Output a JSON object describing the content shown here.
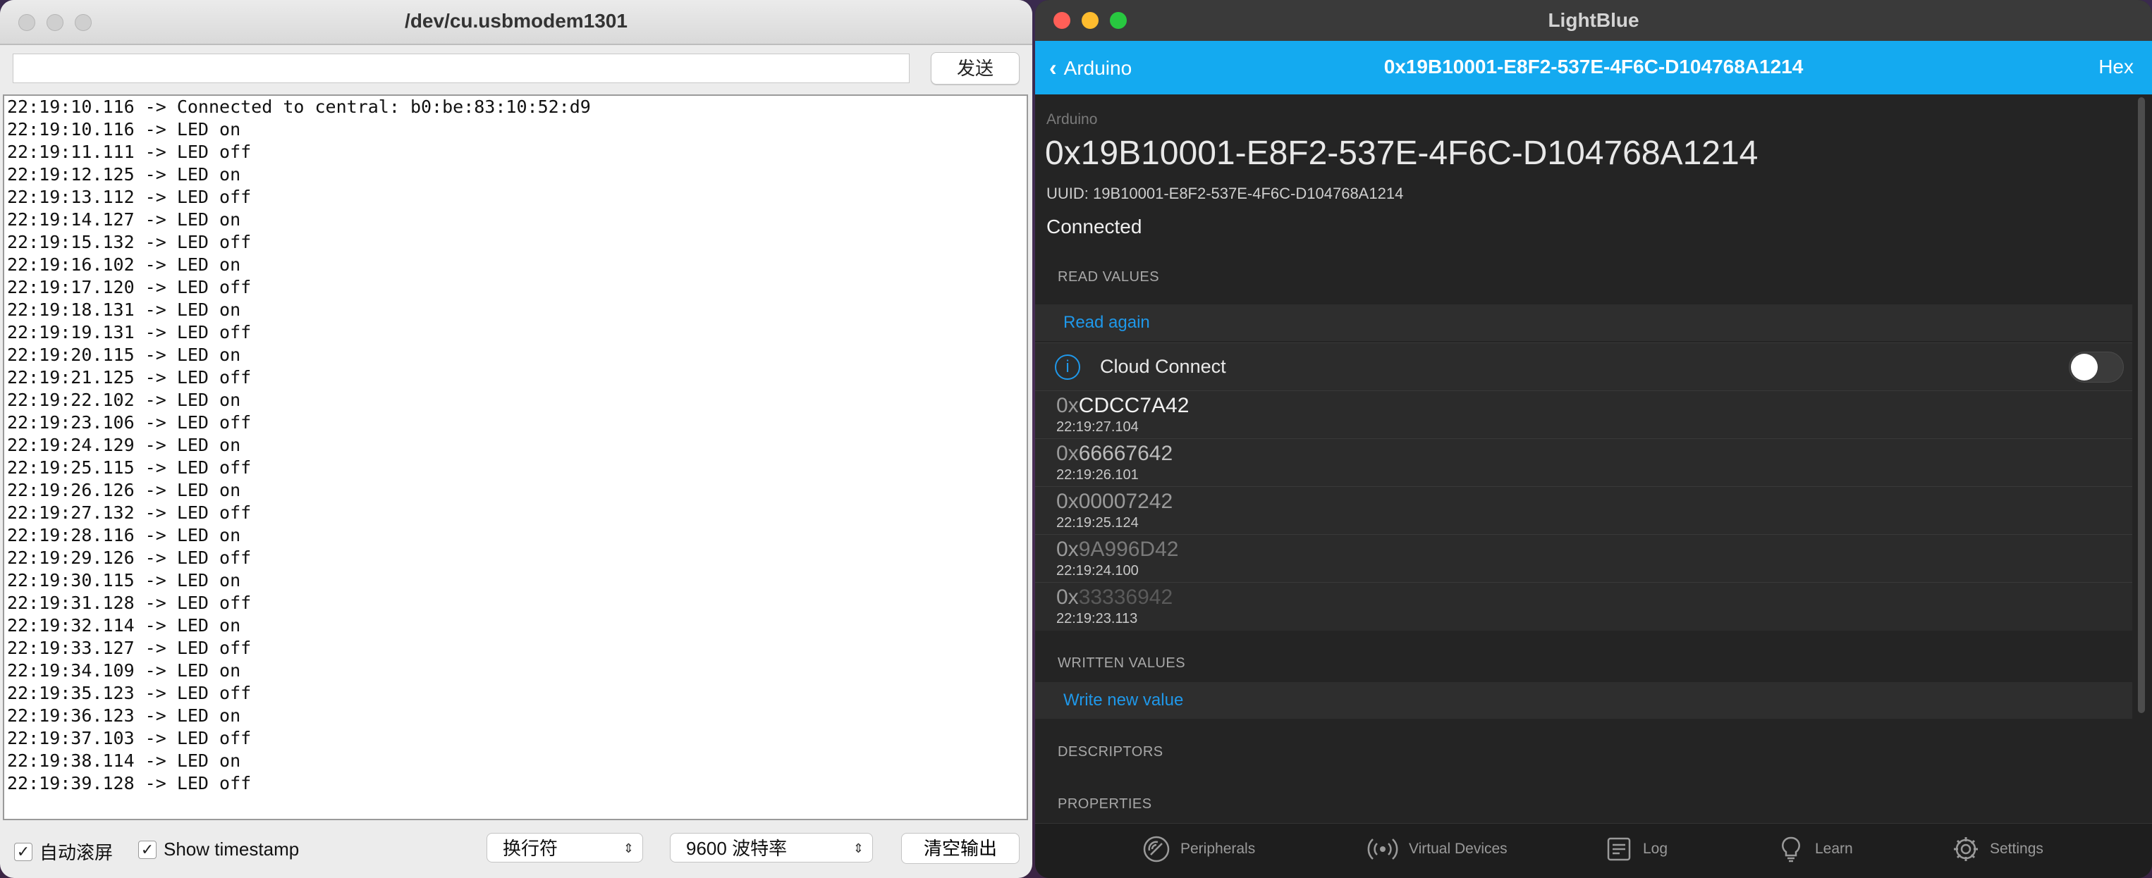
{
  "serial": {
    "title": "/dev/cu.usbmodem1301",
    "send_label": "发送",
    "send_value": "",
    "log": [
      "22:19:10.116 -> Connected to central: b0:be:83:10:52:d9",
      "22:19:10.116 -> LED on",
      "22:19:11.111 -> LED off",
      "22:19:12.125 -> LED on",
      "22:19:13.112 -> LED off",
      "22:19:14.127 -> LED on",
      "22:19:15.132 -> LED off",
      "22:19:16.102 -> LED on",
      "22:19:17.120 -> LED off",
      "22:19:18.131 -> LED on",
      "22:19:19.131 -> LED off",
      "22:19:20.115 -> LED on",
      "22:19:21.125 -> LED off",
      "22:19:22.102 -> LED on",
      "22:19:23.106 -> LED off",
      "22:19:24.129 -> LED on",
      "22:19:25.115 -> LED off",
      "22:19:26.126 -> LED on",
      "22:19:27.132 -> LED off",
      "22:19:28.116 -> LED on",
      "22:19:29.126 -> LED off",
      "22:19:30.115 -> LED on",
      "22:19:31.128 -> LED off",
      "22:19:32.114 -> LED on",
      "22:19:33.127 -> LED off",
      "22:19:34.109 -> LED on",
      "22:19:35.123 -> LED off",
      "22:19:36.123 -> LED on",
      "22:19:37.103 -> LED off",
      "22:19:38.114 -> LED on",
      "22:19:39.128 -> LED off"
    ],
    "autoscroll_label": "自动滚屏",
    "autoscroll_checked": true,
    "timestamp_label": "Show timestamp",
    "timestamp_checked": true,
    "line_ending": "换行符",
    "baud": "9600 波特率",
    "clear_label": "清空输出"
  },
  "lightblue": {
    "title": "LightBlue",
    "back_label": "Arduino",
    "nav_title": "0x19B10001-E8F2-537E-4F6C-D104768A1214",
    "hex_label": "Hex",
    "service_label": "Arduino",
    "big_uuid": "0x19B10001-E8F2-537E-4F6C-D104768A1214",
    "uuid_line": "UUID: 19B10001-E8F2-537E-4F6C-D104768A1214",
    "status": "Connected",
    "read_header": "READ VALUES",
    "read_again": "Read again",
    "cloud_label": "Cloud Connect",
    "cloud_enabled": false,
    "values": [
      {
        "prefix": "0x",
        "hex": "CDCC7A42",
        "time": "22:19:27.104",
        "color": "#f2f2f2"
      },
      {
        "prefix": "0x",
        "hex": "66667642",
        "time": "22:19:26.101",
        "color": "#bdbdbd"
      },
      {
        "prefix": "0x",
        "hex": "00007242",
        "time": "22:19:25.124",
        "color": "#9a9a9a"
      },
      {
        "prefix": "0x",
        "hex": "9A996D42",
        "time": "22:19:24.100",
        "color": "#7a7a7a"
      },
      {
        "prefix": "0x",
        "hex": "33336942",
        "time": "22:19:23.113",
        "color": "#5a5a5a"
      }
    ],
    "written_header": "WRITTEN VALUES",
    "write_new": "Write new value",
    "descriptors_header": "DESCRIPTORS",
    "properties_header": "PROPERTIES",
    "tabs": [
      {
        "label": "Peripherals",
        "icon": "peripherals-icon",
        "active": true
      },
      {
        "label": "Virtual Devices",
        "icon": "virtual-devices-icon",
        "active": false
      },
      {
        "label": "Log",
        "icon": "log-icon",
        "active": false
      },
      {
        "label": "Learn",
        "icon": "lightbulb-icon",
        "active": false
      },
      {
        "label": "Settings",
        "icon": "gear-icon",
        "active": false
      }
    ]
  },
  "colors": {
    "accent_blue": "#14aaf0",
    "link_blue": "#1f98ea",
    "dark_bg": "#242424"
  }
}
